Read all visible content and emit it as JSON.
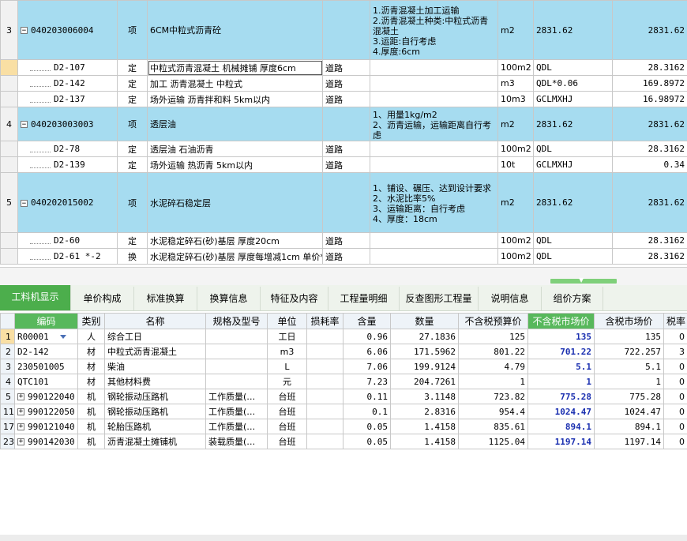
{
  "top_rows": [
    {
      "kind": "item",
      "row": "3",
      "code": "040203006004",
      "type": "项",
      "name": "6CM中粒式沥青砼",
      "part": "",
      "feature": [
        "1.沥青混凝土加工运输",
        "2.沥青混凝土种类:中粒式沥青混凝土",
        "3.运距:自行考虑",
        "4.厚度:6cm"
      ],
      "unit": "m2",
      "qty_expr": "2831.62",
      "qty": "2831.62"
    },
    {
      "kind": "sub",
      "row": "",
      "code": "D2-107",
      "type": "定",
      "name": "中粒式沥青混凝土 机械摊铺 厚度6cm",
      "part": "道路",
      "feature": [],
      "unit": "100m2",
      "qty_expr": "QDL",
      "qty": "28.3162",
      "selected": true
    },
    {
      "kind": "sub",
      "row": "",
      "code": "D2-142",
      "type": "定",
      "name": "加工 沥青混凝土 中粒式",
      "part": "道路",
      "feature": [],
      "unit": "m3",
      "qty_expr": "QDL*0.06",
      "qty": "169.8972"
    },
    {
      "kind": "sub",
      "row": "",
      "code": "D2-137",
      "type": "定",
      "name": "场外运输 沥青拌和料 5km以内",
      "part": "道路",
      "feature": [],
      "unit": "10m3",
      "qty_expr": "GCLMXHJ",
      "qty": "16.98972"
    },
    {
      "kind": "item",
      "row": "4",
      "code": "040203003003",
      "type": "项",
      "name": "透层油",
      "part": "",
      "feature": [
        "1、用量1kg/m2",
        "2、沥青运输，运输距离自行考虑"
      ],
      "unit": "m2",
      "qty_expr": "2831.62",
      "qty": "2831.62"
    },
    {
      "kind": "sub",
      "row": "",
      "code": "D2-78",
      "type": "定",
      "name": "透层油 石油沥青",
      "part": "道路",
      "feature": [],
      "unit": "100m2",
      "qty_expr": "QDL",
      "qty": "28.3162"
    },
    {
      "kind": "sub",
      "row": "",
      "code": "D2-139",
      "type": "定",
      "name": "场外运输 热沥青 5km以内",
      "part": "道路",
      "feature": [],
      "unit": "10t",
      "qty_expr": "GCLMXHJ",
      "qty": "0.34"
    },
    {
      "kind": "item",
      "row": "5",
      "code": "040202015002",
      "type": "项",
      "name": "水泥碎石稳定层",
      "part": "",
      "feature": [
        "1、铺设、碾压、达到设计要求",
        "2、水泥比率5%",
        "3、运输距离：自行考虑",
        "4、厚度：18cm"
      ],
      "unit": "m2",
      "qty_expr": "2831.62",
      "qty": "2831.62"
    },
    {
      "kind": "sub",
      "row": "",
      "code": "D2-60",
      "type": "定",
      "name": "水泥稳定碎石(砂)基层 厚度20cm",
      "part": "道路",
      "feature": [],
      "unit": "100m2",
      "qty_expr": "QDL",
      "qty": "28.3162"
    },
    {
      "kind": "sub",
      "row": "",
      "code": "D2-61 *-2",
      "type": "换",
      "name": "水泥稳定碎石(砂)基层 厚度每增减1cm 单价*-2",
      "part": "道路",
      "feature": [],
      "unit": "100m2",
      "qty_expr": "QDL",
      "qty": "28.3162"
    }
  ],
  "tabs": [
    "工料机显示",
    "单价构成",
    "标准换算",
    "换算信息",
    "特征及内容",
    "工程量明细",
    "反查图形工程量",
    "说明信息",
    "组价方案"
  ],
  "columns": [
    "编码",
    "类别",
    "名称",
    "规格及型号",
    "单位",
    "损耗率",
    "含量",
    "数量",
    "不含税预算价",
    "不含税市场价",
    "含税市场价",
    "税率"
  ],
  "rows": [
    {
      "idx": "1",
      "code": "R00001",
      "cat": "人",
      "name": "综合工日",
      "spec": "",
      "unit": "工日",
      "loss": "",
      "content": "0.96",
      "qty": "27.1836",
      "budget": "125",
      "market": "135",
      "tax_market": "135",
      "rate": "0",
      "expand": false,
      "selected": true,
      "dropdown": true
    },
    {
      "idx": "2",
      "code": "D2-142",
      "cat": "材",
      "name": "中粒式沥青混凝土",
      "spec": "",
      "unit": "m3",
      "loss": "",
      "content": "6.06",
      "qty": "171.5962",
      "budget": "801.22",
      "market": "701.22",
      "tax_market": "722.257",
      "rate": "3",
      "expand": false
    },
    {
      "idx": "3",
      "code": "230501005",
      "cat": "材",
      "name": "柴油",
      "spec": "",
      "unit": "L",
      "loss": "",
      "content": "7.06",
      "qty": "199.9124",
      "budget": "4.79",
      "market": "5.1",
      "tax_market": "5.1",
      "rate": "0",
      "expand": false
    },
    {
      "idx": "4",
      "code": "QTC101",
      "cat": "材",
      "name": "其他材料费",
      "spec": "",
      "unit": "元",
      "loss": "",
      "content": "7.23",
      "qty": "204.7261",
      "budget": "1",
      "market": "1",
      "tax_market": "1",
      "rate": "0",
      "expand": false
    },
    {
      "idx": "5",
      "code": "990122040",
      "cat": "机",
      "name": "钢轮振动压路机",
      "spec": "工作质量(…",
      "unit": "台班",
      "loss": "",
      "content": "0.11",
      "qty": "3.1148",
      "budget": "723.82",
      "market": "775.28",
      "tax_market": "775.28",
      "rate": "0",
      "expand": true
    },
    {
      "idx": "11",
      "code": "990122050",
      "cat": "机",
      "name": "钢轮振动压路机",
      "spec": "工作质量(…",
      "unit": "台班",
      "loss": "",
      "content": "0.1",
      "qty": "2.8316",
      "budget": "954.4",
      "market": "1024.47",
      "tax_market": "1024.47",
      "rate": "0",
      "expand": true
    },
    {
      "idx": "17",
      "code": "990121040",
      "cat": "机",
      "name": "轮胎压路机",
      "spec": "工作质量(…",
      "unit": "台班",
      "loss": "",
      "content": "0.05",
      "qty": "1.4158",
      "budget": "835.61",
      "market": "894.1",
      "tax_market": "894.1",
      "rate": "0",
      "expand": true
    },
    {
      "idx": "23",
      "code": "990142030",
      "cat": "机",
      "name": "沥青混凝土摊铺机",
      "spec": "装载质量(…",
      "unit": "台班",
      "loss": "",
      "content": "0.05",
      "qty": "1.4158",
      "budget": "1125.04",
      "market": "1197.14",
      "tax_market": "1197.14",
      "rate": "0",
      "expand": true
    }
  ],
  "colors": {
    "item_row": "#a6dcf0",
    "active_tab": "#4cae4c",
    "highlight_header": "#58b85c",
    "market_price_text": "#1a2fb0"
  }
}
